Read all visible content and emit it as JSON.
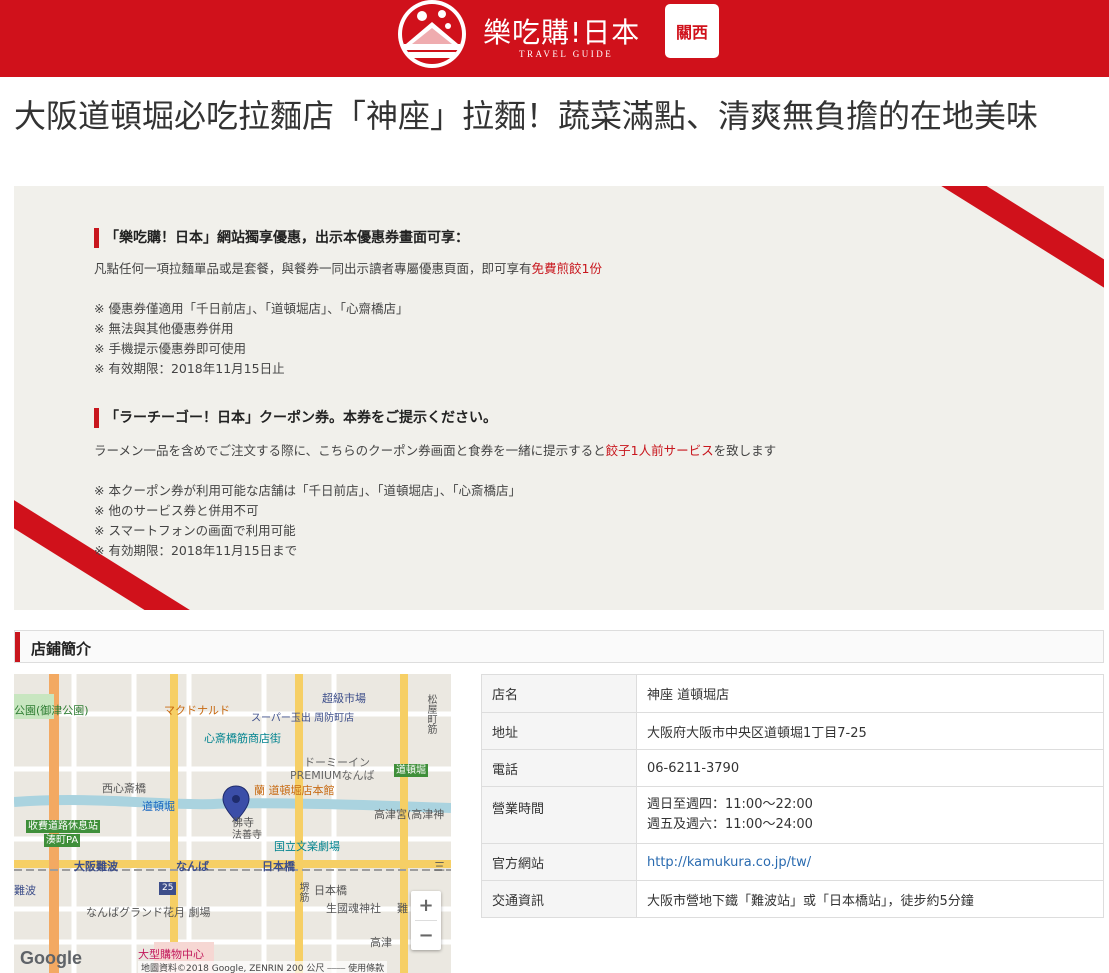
{
  "header": {
    "logo_title": "樂吃購!日本",
    "logo_subtitle": "TRAVEL GUIDE",
    "region": "關西",
    "brand_color": "#d0111b"
  },
  "article": {
    "title": "大阪道頓堀必吃拉麵店「神座」拉麵！蔬菜滿點、清爽無負擔的在地美味"
  },
  "coupon": {
    "zh_heading": "「樂吃購！日本」網站獨享優惠，出示本優惠券畫面可享：",
    "zh_desc_prefix": "凡點任何一項拉麵單品或是套餐，與餐券一同出示讀者專屬優惠頁面，即可享有",
    "zh_desc_highlight": "免費煎餃1份",
    "zh_notes": [
      "※ 優惠券僅適用「千日前店」、「道頓堀店」、「心齋橋店」",
      "※ 無法與其他優惠券併用",
      "※ 手機提示優惠券即可使用",
      "※ 有效期限：2018年11月15日止"
    ],
    "ja_heading": "「ラーチーゴー！日本」クーポン券。本券をご提示ください。",
    "ja_desc_prefix": "ラーメン一品を含めでご注文する際に、こちらのクーポン券画面と食券を一緒に提示すると",
    "ja_desc_highlight": "餃子1人前サービス",
    "ja_desc_suffix": "を致します",
    "ja_notes": [
      "※ 本クーポン券が利用可能な店舗は「千日前店」、「道頓堀店」、「心斎橋店」",
      "※ 他のサービス券と併用不可",
      "※ スマートフォンの画面で利用可能",
      "※ 有効期限：2018年11月15日まで"
    ]
  },
  "section": {
    "title": "店鋪簡介"
  },
  "map": {
    "labels": {
      "park": "公園(御津公園)",
      "mcd": "マクドナルド",
      "supermarket": "超級市場",
      "super_tamade": "スーパー玉出 周防町店",
      "matsuyamachi": "松屋町筋",
      "shinsaibashi_street": "心斎橋筋商店街",
      "dormy": "ドーミーイン",
      "premium": "PREMIUMなんば",
      "dotonbori_badge": "道頓堀",
      "nishishinsaibashi": "西心斎橋",
      "ran": "蘭 道頓堀店本館",
      "dotonbori": "道頓堀",
      "kozu": "高津宮(高津神",
      "toll_station": "收費道路休息站",
      "minatomachi": "湊町PA",
      "temple1": "佛寺",
      "temple2": "法善寺",
      "bunraku": "国立文楽劇場",
      "osaka_namba": "大阪難波",
      "namba": "なんば",
      "nipponbashi_station": "日本橋",
      "route25": "25",
      "sakai_suji": "堺筋",
      "nipponbashi": "日本橋",
      "san": "三",
      "namba_left": "難波",
      "namba_grand": "なんばグランド花月 劇場",
      "ikukunitama": "生國魂神社",
      "nan": "難",
      "kozu2": "高津",
      "shopping_center": "大型購物中心",
      "google": "Google",
      "footer": "地圖資料©2018 Google, ZENRIN   200 公尺 ⎯⎯⎯⎯   使用條款",
      "zoom_in": "+",
      "zoom_out": "−"
    }
  },
  "info": {
    "rows": [
      {
        "key": "店名",
        "value": "神座 道頓堀店"
      },
      {
        "key": "地址",
        "value": "大阪府大阪市中央区道頓堀1丁目7-25"
      },
      {
        "key": "電話",
        "value": "06-6211-3790"
      },
      {
        "key": "營業時間",
        "value": "週日至週四：11:00～22:00",
        "value2": "週五及週六：11:00～24:00"
      },
      {
        "key": "官方網站",
        "value": "http://kamukura.co.jp/tw/"
      },
      {
        "key": "交通資訊",
        "value": "大阪市營地下鐵「難波站」或「日本橋站」，徒步約5分鐘"
      }
    ]
  }
}
